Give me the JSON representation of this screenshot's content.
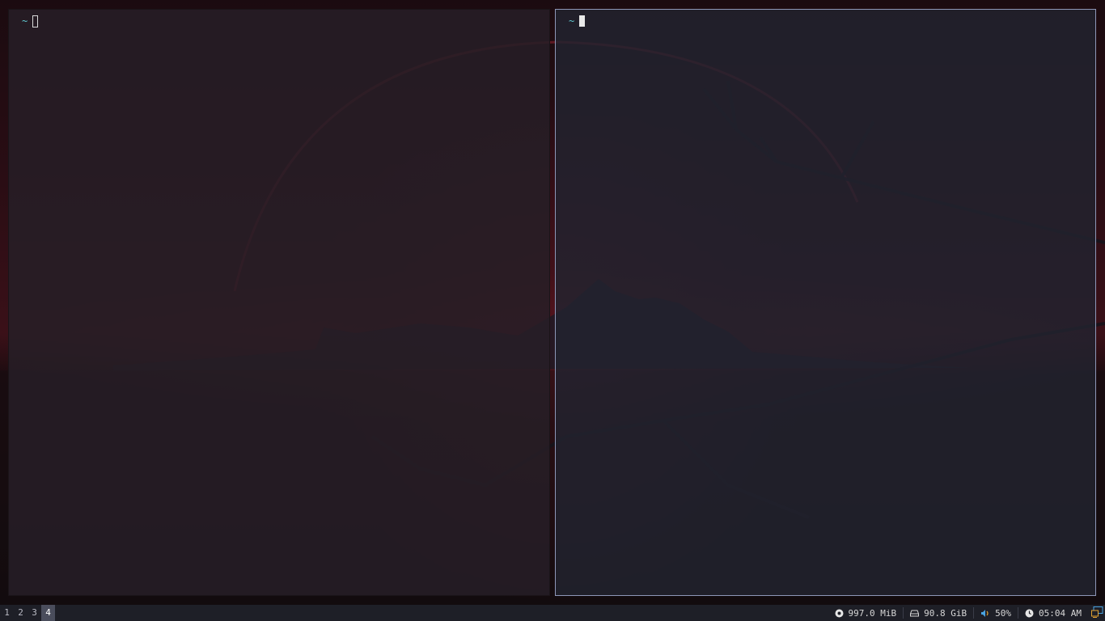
{
  "terminals": [
    {
      "prompt": "~",
      "focused": false
    },
    {
      "prompt": "~",
      "focused": true
    }
  ],
  "workspaces": [
    {
      "label": "1",
      "active": false
    },
    {
      "label": "2",
      "active": false
    },
    {
      "label": "3",
      "active": false
    },
    {
      "label": "4",
      "active": true
    }
  ],
  "status": {
    "memory": "997.0 MiB",
    "disk": "90.8 GiB",
    "volume": "50%",
    "time": "05:04 AM"
  },
  "icons": {
    "memory": "memory-icon",
    "disk": "disk-icon",
    "volume": "speaker-icon",
    "clock": "clock-icon",
    "tray": "network-tray-icon"
  },
  "colors": {
    "prompt": "#5fc7cf",
    "focused_border": "#8e97b8",
    "bar_bg": "#1e1f27",
    "active_workspace": "#4a4d5c",
    "volume_icon": "#4aa3e0"
  }
}
